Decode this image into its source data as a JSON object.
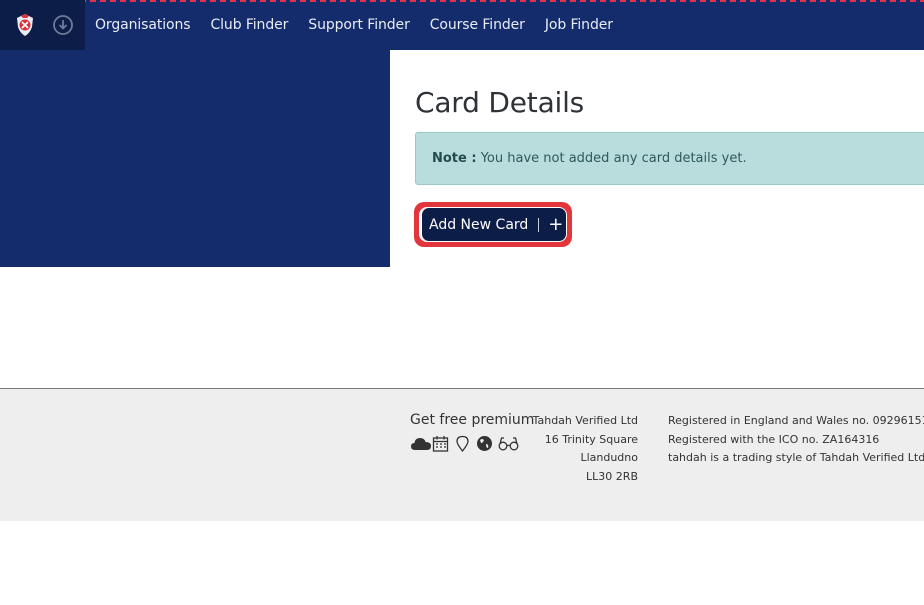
{
  "nav": {
    "items": [
      {
        "label": "Organisations"
      },
      {
        "label": "Club Finder"
      },
      {
        "label": "Support Finder"
      },
      {
        "label": "Course Finder"
      },
      {
        "label": "Job Finder"
      }
    ]
  },
  "main": {
    "title": "Card Details",
    "note_label": "Note :",
    "note_text": "You have not added any card details yet.",
    "add_button_label": "Add New Card",
    "add_button_icon": "+"
  },
  "footer": {
    "premium_title": "Get free premium",
    "premium_icons": [
      "cloud-icon",
      "calendar-icon",
      "map-pin-icon",
      "globe-icon",
      "glasses-icon"
    ],
    "address": [
      "Tahdah Verified Ltd",
      "16 Trinity Square",
      "Llandudno",
      "LL30 2RB"
    ],
    "registration": [
      "Registered in England and Wales no. 09296151",
      "Registered with the ICO no. ZA164316",
      "tahdah is a trading style of Tahdah Verified Ltd"
    ]
  },
  "colors": {
    "navy": "#142c6b",
    "dark_navy": "#0c1d47",
    "accent_red": "#e2363c",
    "note_bg": "#b9dcdc"
  }
}
